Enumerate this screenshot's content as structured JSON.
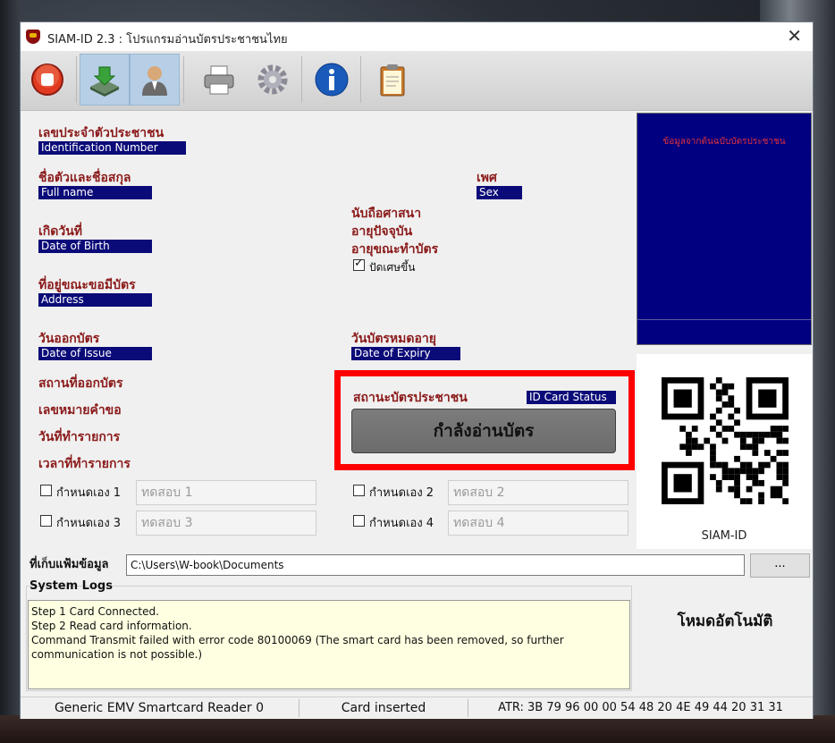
{
  "window": {
    "title": "SIAM-ID 2.3 : โปรแกรมอ่านบัตรประชาชนไทย"
  },
  "toolbar": {
    "buttons": [
      {
        "name": "stop",
        "icon": "stop-icon"
      },
      {
        "name": "read-card",
        "icon": "card-reader-icon"
      },
      {
        "name": "person",
        "icon": "person-icon"
      },
      {
        "name": "print",
        "icon": "printer-icon"
      },
      {
        "name": "settings",
        "icon": "gear-icon"
      },
      {
        "name": "info",
        "icon": "info-icon"
      },
      {
        "name": "clipboard",
        "icon": "clipboard-icon"
      }
    ]
  },
  "fields": {
    "id_number": {
      "th": "เลขประจำตัวประชาชน",
      "en": "Identification Number"
    },
    "full_name": {
      "th": "ชื่อตัวและชื่อสกุล",
      "en": "Full name"
    },
    "sex": {
      "th": "เพศ",
      "en": "Sex"
    },
    "religion": {
      "th": "นับถือศาสนา"
    },
    "current_age": {
      "th": "อายุปัจจุบัน"
    },
    "age_at_issue": {
      "th": "อายุขณะทำบัตร"
    },
    "round_up": {
      "label": "ปัดเศษขึ้น",
      "checked": true
    },
    "dob": {
      "th": "เกิดวันที่",
      "en": "Date of Birth"
    },
    "address": {
      "th": "ที่อยู่ขณะขอมีบัตร",
      "en": "Address"
    },
    "issue_date": {
      "th": "วันออกบัตร",
      "en": "Date of Issue"
    },
    "expiry_date": {
      "th": "วันบัตรหมดอายุ",
      "en": "Date of Expiry"
    },
    "issue_place": {
      "th": "สถานที่ออกบัตร"
    },
    "request_no": {
      "th": "เลขหมายคำขอ"
    },
    "transaction_date": {
      "th": "วันที่ทำรายการ"
    },
    "transaction_time": {
      "th": "เวลาที่ทำรายการ"
    }
  },
  "card_status": {
    "th": "สถานะบัตรประชาชน",
    "en": "ID Card Status",
    "value": "กำลังอ่านบัตร"
  },
  "photo": {
    "text": "ข้อมูลจากต้นฉบับบัตรประชาชน"
  },
  "qr": {
    "caption": "SIAM-ID"
  },
  "custom": [
    {
      "label": "กำหนดเอง 1",
      "placeholder": "ทดสอบ 1",
      "checked": false
    },
    {
      "label": "กำหนดเอง 2",
      "placeholder": "ทดสอบ 2",
      "checked": false
    },
    {
      "label": "กำหนดเอง 3",
      "placeholder": "ทดสอบ 3",
      "checked": false
    },
    {
      "label": "กำหนดเอง 4",
      "placeholder": "ทดสอบ 4",
      "checked": false
    }
  ],
  "storage": {
    "label": "ที่เก็บแฟ้มข้อมูล",
    "path": "C:\\Users\\W-book\\Documents",
    "browse_label": "..."
  },
  "logs": {
    "label": "System Logs",
    "lines": [
      "Step 1 Card Connected.",
      "Step 2 Read card information.",
      "Command Transmit failed with error code 80100069 (The smart card has been removed, so further communication is not possible.)"
    ]
  },
  "auto_mode": "โหมดอัตโนมัติ",
  "statusbar": {
    "reader": "Generic EMV Smartcard Reader 0",
    "card_state": "Card inserted",
    "atr": "ATR: 3B 79 96 00 00 54 48 20 4E 49 44 20 31 31"
  }
}
